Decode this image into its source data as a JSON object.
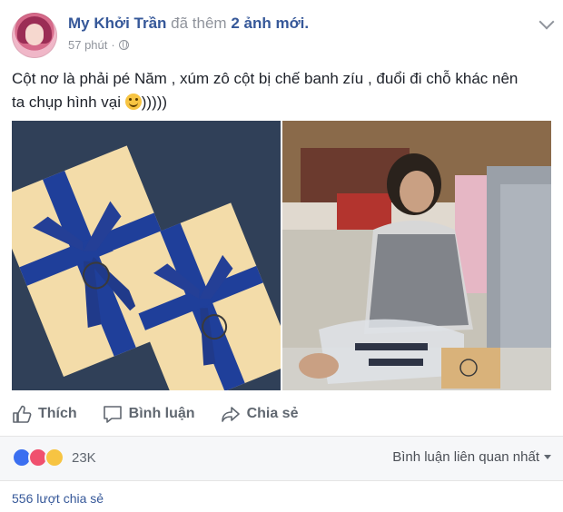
{
  "header": {
    "author": "My Khởi Trần",
    "action_prefix": "đã thêm",
    "action_count": "2 ảnh mới.",
    "time": "57 phút",
    "audience_icon": "globe-icon",
    "menu_icon": "chevron-down-icon"
  },
  "post": {
    "text_line1": "Cột nơ là phải pé Năm , xúm zô cột bị chế banh zíu , đuổi đi chỗ khác nên",
    "text_line2": "ta chụp hình vại",
    "text_suffix": ")))))",
    "emoji_icon": "smile-emoji-icon"
  },
  "actions": {
    "like": "Thích",
    "comment": "Bình luận",
    "share": "Chia sẻ"
  },
  "reactions": {
    "count": "23K",
    "icons": [
      "like-icon",
      "love-icon",
      "haha-icon"
    ],
    "sort_label": "Bình luận liên quan nhất"
  },
  "shares": {
    "label": "556 lượt chia sẻ"
  },
  "colors": {
    "link_blue": "#365899",
    "meta_gray": "#90949c",
    "ribbon_blue": "#1f3f9a"
  }
}
